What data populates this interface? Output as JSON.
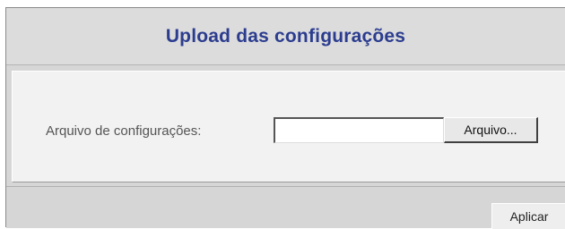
{
  "header": {
    "title": "Upload das configurações"
  },
  "form": {
    "file_label": "Arquivo de configurações:",
    "file_value": "",
    "browse_label": "Arquivo..."
  },
  "footer": {
    "apply_label": "Aplicar"
  },
  "colors": {
    "title_text": "#2c3d8f",
    "panel_background": "#d6d6d6",
    "form_background": "#f2f2f2"
  }
}
